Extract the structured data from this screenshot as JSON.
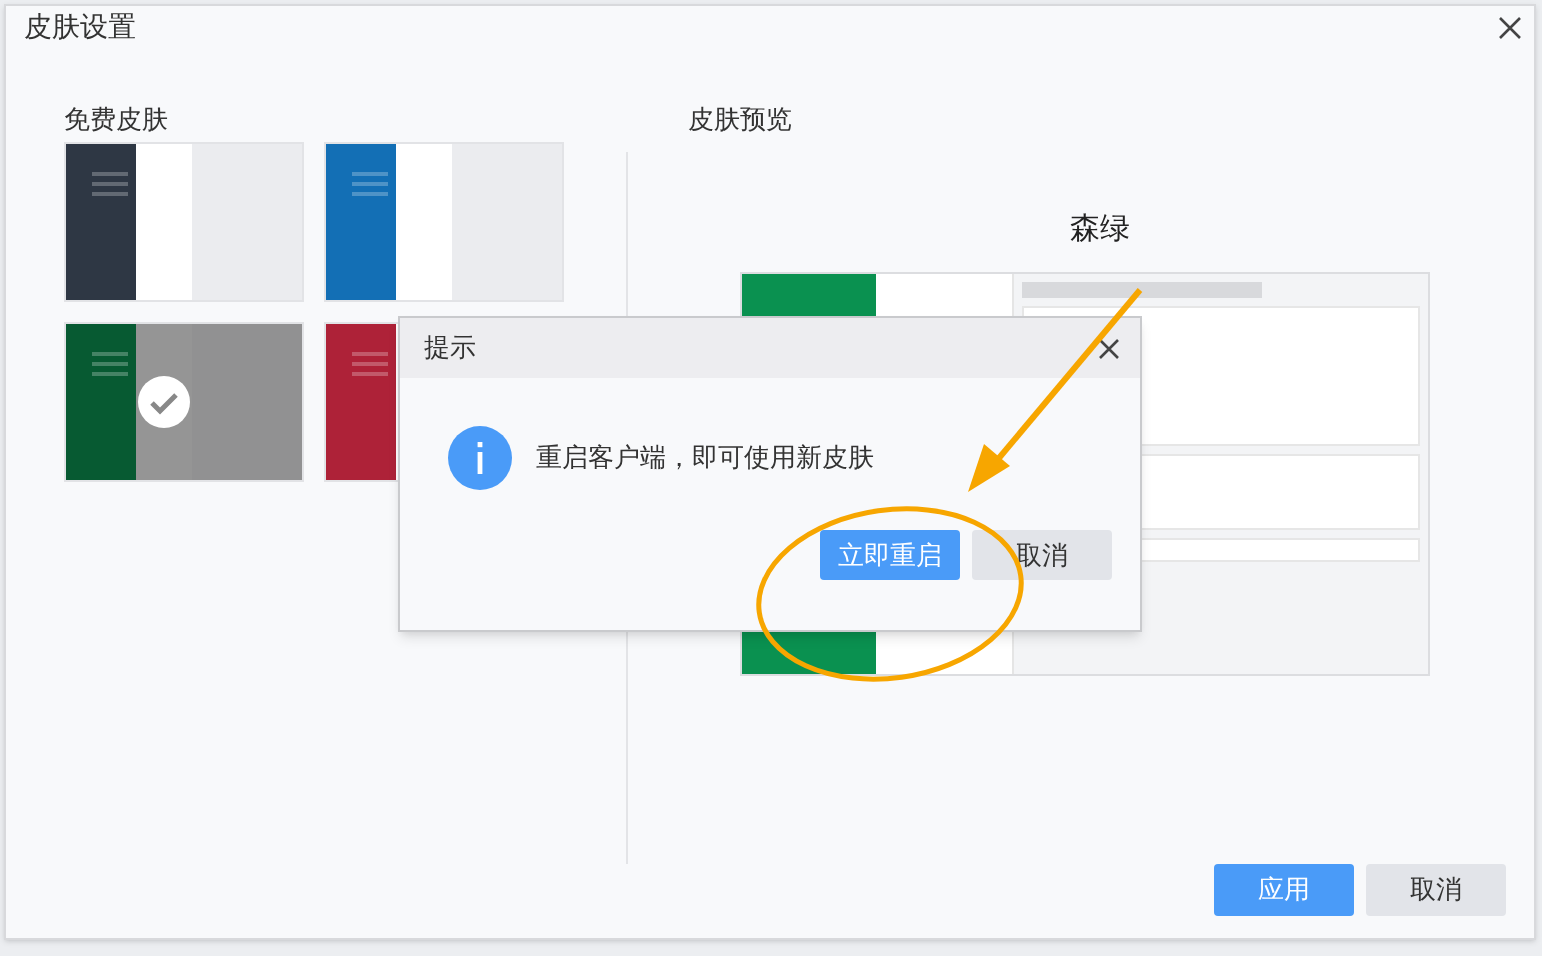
{
  "window": {
    "title": "皮肤设置"
  },
  "free_skins": {
    "heading": "免费皮肤",
    "items": [
      {
        "color": "#2e3744",
        "selected": false
      },
      {
        "color": "#136fb5",
        "selected": false
      },
      {
        "color": "#075a32",
        "selected": true
      },
      {
        "color": "#ae2238",
        "selected": false
      }
    ]
  },
  "preview": {
    "heading": "皮肤预览",
    "skin_name": "森绿"
  },
  "dialog": {
    "title": "提示",
    "message": "重启客户端，即可使用新皮肤",
    "buttons": [
      {
        "label": "立即重启",
        "kind": "primary"
      },
      {
        "label": "取消",
        "kind": "secondary"
      }
    ]
  },
  "footer_buttons": [
    {
      "label": "应用",
      "kind": "primary"
    },
    {
      "label": "取消",
      "kind": "secondary"
    }
  ]
}
